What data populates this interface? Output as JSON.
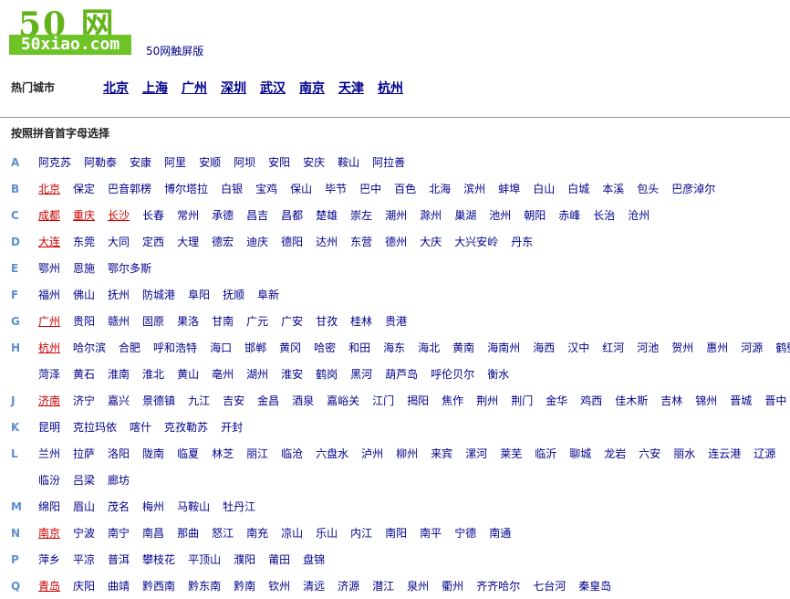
{
  "logo": {
    "top_text": "50 网",
    "bottom_text": "50xiao.com"
  },
  "touch_link": "50网触屏版",
  "hot": {
    "label": "热门城市",
    "cities": [
      "北京",
      "上海",
      "广州",
      "深圳",
      "武汉",
      "南京",
      "天津",
      "杭州"
    ]
  },
  "pinyin_label": "按照拼音首字母选择",
  "rows": [
    {
      "letter": "A",
      "cities": [
        {
          "name": "阿克苏"
        },
        {
          "name": "阿勒泰"
        },
        {
          "name": "安康"
        },
        {
          "name": "阿里"
        },
        {
          "name": "安顺"
        },
        {
          "name": "阿坝"
        },
        {
          "name": "安阳"
        },
        {
          "name": "安庆"
        },
        {
          "name": "鞍山"
        },
        {
          "name": "阿拉善"
        }
      ]
    },
    {
      "letter": "B",
      "cities": [
        {
          "name": "北京",
          "hot": true
        },
        {
          "name": "保定"
        },
        {
          "name": "巴音郭楞"
        },
        {
          "name": "博尔塔拉"
        },
        {
          "name": "白银"
        },
        {
          "name": "宝鸡"
        },
        {
          "name": "保山"
        },
        {
          "name": "毕节"
        },
        {
          "name": "巴中"
        },
        {
          "name": "百色"
        },
        {
          "name": "北海"
        },
        {
          "name": "滨州"
        },
        {
          "name": "蚌埠"
        },
        {
          "name": "白山"
        },
        {
          "name": "白城"
        },
        {
          "name": "本溪"
        },
        {
          "name": "包头"
        },
        {
          "name": "巴彦淖尔"
        }
      ]
    },
    {
      "letter": "C",
      "cities": [
        {
          "name": "成都",
          "hot": true
        },
        {
          "name": "重庆",
          "hot": true
        },
        {
          "name": "长沙",
          "hot": true
        },
        {
          "name": "长春"
        },
        {
          "name": "常州"
        },
        {
          "name": "承德"
        },
        {
          "name": "昌吉"
        },
        {
          "name": "昌都"
        },
        {
          "name": "楚雄"
        },
        {
          "name": "崇左"
        },
        {
          "name": "潮州"
        },
        {
          "name": "滁州"
        },
        {
          "name": "巢湖"
        },
        {
          "name": "池州"
        },
        {
          "name": "朝阳"
        },
        {
          "name": "赤峰"
        },
        {
          "name": "长治"
        },
        {
          "name": "沧州"
        }
      ]
    },
    {
      "letter": "D",
      "cities": [
        {
          "name": "大连",
          "hot": true
        },
        {
          "name": "东莞"
        },
        {
          "name": "大同"
        },
        {
          "name": "定西"
        },
        {
          "name": "大理"
        },
        {
          "name": "德宏"
        },
        {
          "name": "迪庆"
        },
        {
          "name": "德阳"
        },
        {
          "name": "达州"
        },
        {
          "name": "东营"
        },
        {
          "name": "德州"
        },
        {
          "name": "大庆"
        },
        {
          "name": "大兴安岭"
        },
        {
          "name": "丹东"
        }
      ]
    },
    {
      "letter": "E",
      "cities": [
        {
          "name": "鄂州"
        },
        {
          "name": "恩施"
        },
        {
          "name": "鄂尔多斯"
        }
      ]
    },
    {
      "letter": "F",
      "cities": [
        {
          "name": "福州"
        },
        {
          "name": "佛山"
        },
        {
          "name": "抚州"
        },
        {
          "name": "防城港"
        },
        {
          "name": "阜阳"
        },
        {
          "name": "抚顺"
        },
        {
          "name": "阜新"
        }
      ]
    },
    {
      "letter": "G",
      "cities": [
        {
          "name": "广州",
          "hot": true
        },
        {
          "name": "贵阳"
        },
        {
          "name": "赣州"
        },
        {
          "name": "固原"
        },
        {
          "name": "果洛"
        },
        {
          "name": "甘南"
        },
        {
          "name": "广元"
        },
        {
          "name": "广安"
        },
        {
          "name": "甘孜"
        },
        {
          "name": "桂林"
        },
        {
          "name": "贵港"
        }
      ]
    },
    {
      "letter": "H",
      "cities": [
        {
          "name": "杭州",
          "hot": true
        },
        {
          "name": "哈尔滨"
        },
        {
          "name": "合肥"
        },
        {
          "name": "呼和浩特"
        },
        {
          "name": "海口"
        },
        {
          "name": "邯郸"
        },
        {
          "name": "黄冈"
        },
        {
          "name": "哈密"
        },
        {
          "name": "和田"
        },
        {
          "name": "海东"
        },
        {
          "name": "海北"
        },
        {
          "name": "黄南"
        },
        {
          "name": "海南州"
        },
        {
          "name": "海西"
        },
        {
          "name": "汉中"
        },
        {
          "name": "红河"
        },
        {
          "name": "河池"
        },
        {
          "name": "贺州"
        },
        {
          "name": "惠州"
        },
        {
          "name": "河源"
        },
        {
          "name": "鹤壁"
        }
      ]
    },
    {
      "letter": "",
      "cities": [
        {
          "name": "菏泽"
        },
        {
          "name": "黄石"
        },
        {
          "name": "淮南"
        },
        {
          "name": "淮北"
        },
        {
          "name": "黄山"
        },
        {
          "name": "亳州"
        },
        {
          "name": "湖州"
        },
        {
          "name": "淮安"
        },
        {
          "name": "鹤岗"
        },
        {
          "name": "黑河"
        },
        {
          "name": "葫芦岛"
        },
        {
          "name": "呼伦贝尔"
        },
        {
          "name": "衡水"
        }
      ]
    },
    {
      "letter": "J",
      "cities": [
        {
          "name": "济南",
          "hot": true
        },
        {
          "name": "济宁"
        },
        {
          "name": "嘉兴"
        },
        {
          "name": "景德镇"
        },
        {
          "name": "九江"
        },
        {
          "name": "吉安"
        },
        {
          "name": "金昌"
        },
        {
          "name": "酒泉"
        },
        {
          "name": "嘉峪关"
        },
        {
          "name": "江门"
        },
        {
          "name": "揭阳"
        },
        {
          "name": "焦作"
        },
        {
          "name": "荆州"
        },
        {
          "name": "荆门"
        },
        {
          "name": "金华"
        },
        {
          "name": "鸡西"
        },
        {
          "name": "佳木斯"
        },
        {
          "name": "吉林"
        },
        {
          "name": "锦州"
        },
        {
          "name": "晋城"
        },
        {
          "name": "晋中"
        }
      ]
    },
    {
      "letter": "K",
      "cities": [
        {
          "name": "昆明"
        },
        {
          "name": "克拉玛依"
        },
        {
          "name": "喀什"
        },
        {
          "name": "克孜勒苏"
        },
        {
          "name": "开封"
        }
      ]
    },
    {
      "letter": "L",
      "cities": [
        {
          "name": "兰州"
        },
        {
          "name": "拉萨"
        },
        {
          "name": "洛阳"
        },
        {
          "name": "陇南"
        },
        {
          "name": "临夏"
        },
        {
          "name": "林芝"
        },
        {
          "name": "丽江"
        },
        {
          "name": "临沧"
        },
        {
          "name": "六盘水"
        },
        {
          "name": "泸州"
        },
        {
          "name": "柳州"
        },
        {
          "name": "来宾"
        },
        {
          "name": "漯河"
        },
        {
          "name": "莱芜"
        },
        {
          "name": "临沂"
        },
        {
          "name": "聊城"
        },
        {
          "name": "龙岩"
        },
        {
          "name": "六安"
        },
        {
          "name": "丽水"
        },
        {
          "name": "连云港"
        },
        {
          "name": "辽源"
        }
      ]
    },
    {
      "letter": "",
      "cities": [
        {
          "name": "临汾"
        },
        {
          "name": "吕梁"
        },
        {
          "name": "廊坊"
        }
      ]
    },
    {
      "letter": "M",
      "cities": [
        {
          "name": "绵阳"
        },
        {
          "name": "眉山"
        },
        {
          "name": "茂名"
        },
        {
          "name": "梅州"
        },
        {
          "name": "马鞍山"
        },
        {
          "name": "牡丹江"
        }
      ]
    },
    {
      "letter": "N",
      "cities": [
        {
          "name": "南京",
          "hot": true
        },
        {
          "name": "宁波"
        },
        {
          "name": "南宁"
        },
        {
          "name": "南昌"
        },
        {
          "name": "那曲"
        },
        {
          "name": "怒江"
        },
        {
          "name": "南充"
        },
        {
          "name": "凉山"
        },
        {
          "name": "乐山"
        },
        {
          "name": "内江"
        },
        {
          "name": "南阳"
        },
        {
          "name": "南平"
        },
        {
          "name": "宁德"
        },
        {
          "name": "南通"
        }
      ]
    },
    {
      "letter": "P",
      "cities": [
        {
          "name": "萍乡"
        },
        {
          "name": "平凉"
        },
        {
          "name": "普洱"
        },
        {
          "name": "攀枝花"
        },
        {
          "name": "平顶山"
        },
        {
          "name": "濮阳"
        },
        {
          "name": "莆田"
        },
        {
          "name": "盘锦"
        }
      ]
    },
    {
      "letter": "Q",
      "cities": [
        {
          "name": "青岛",
          "hot": true
        },
        {
          "name": "庆阳"
        },
        {
          "name": "曲靖"
        },
        {
          "name": "黔西南"
        },
        {
          "name": "黔东南"
        },
        {
          "name": "黔南"
        },
        {
          "name": "钦州"
        },
        {
          "name": "清远"
        },
        {
          "name": "济源"
        },
        {
          "name": "潜江"
        },
        {
          "name": "泉州"
        },
        {
          "name": "衢州"
        },
        {
          "name": "齐齐哈尔"
        },
        {
          "name": "七台河"
        },
        {
          "name": "秦皇岛"
        }
      ]
    }
  ]
}
